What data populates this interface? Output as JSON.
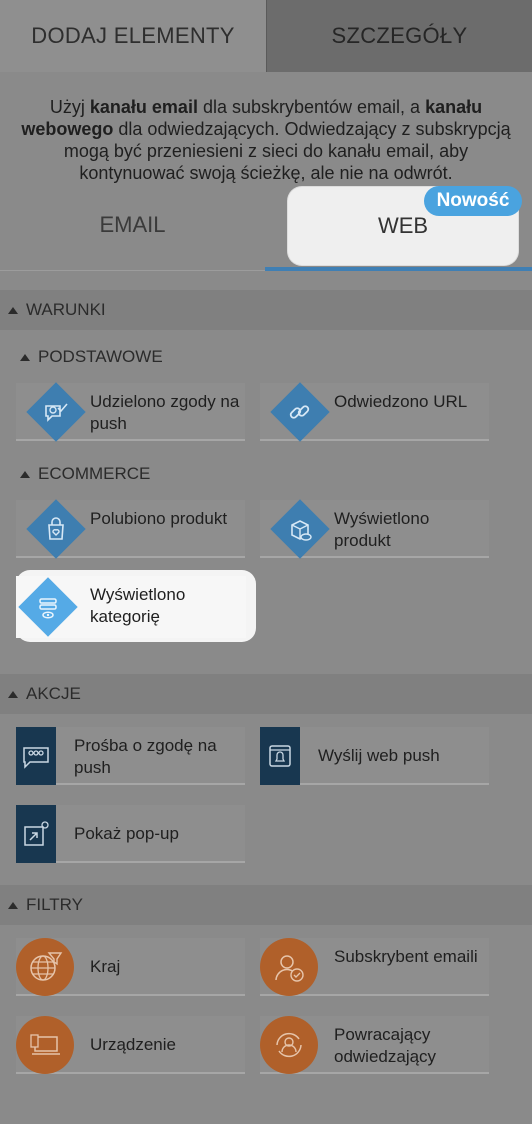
{
  "tabs": {
    "add_elements": "DODAJ ELEMENTY",
    "details": "SZCZEGÓŁY"
  },
  "intro": {
    "part1": "Użyj ",
    "bold1": "kanału email",
    "part2": " dla subskrybentów email, a ",
    "bold2": "kanału webowego",
    "part3": " dla odwiedzających. Odwiedzający z subskrypcją mogą być przeniesieni z sieci do kanału email, aby kontynuować swoją ścieżkę, ale nie na odwrót."
  },
  "channels": {
    "email": "EMAIL",
    "web": "WEB",
    "new_badge": "Nowość"
  },
  "sections": {
    "conditions": "WARUNKI",
    "basic": "PODSTAWOWE",
    "ecommerce": "ECOMMERCE",
    "actions": "AKCJE",
    "filters": "FILTRY"
  },
  "basic_items": [
    {
      "label": "Udzielono zgody na push",
      "icon": "push-consent-icon"
    },
    {
      "label": "Odwiedzono URL",
      "icon": "link-icon"
    }
  ],
  "ecommerce_items": [
    {
      "label": "Polubiono produkt",
      "icon": "liked-product-icon"
    },
    {
      "label": "Wyświetlono produkt",
      "icon": "viewed-product-icon"
    },
    {
      "label": "Wyświetlono kategorię",
      "icon": "viewed-category-icon"
    }
  ],
  "action_items": [
    {
      "label": "Prośba o zgodę na push",
      "icon": "consent-request-icon"
    },
    {
      "label": "Wyślij web push",
      "icon": "web-push-icon"
    },
    {
      "label": "Pokaż pop-up",
      "icon": "popup-icon"
    }
  ],
  "filter_items": [
    {
      "label": "Kraj",
      "icon": "globe-filter-icon"
    },
    {
      "label": "Subskrybent emaili",
      "icon": "subscriber-check-icon"
    },
    {
      "label": "Urządzenie",
      "icon": "device-icon"
    },
    {
      "label": "Powracający odwiedzający",
      "icon": "returning-visitor-icon"
    }
  ],
  "colors": {
    "diamond_blue": "#3e7eb0",
    "diamond_light": "#55aae6",
    "action_navy": "#183750",
    "filter_orange": "#b0602a",
    "badge_blue": "#4aa3df",
    "tab_underline": "#3f7fb4"
  }
}
